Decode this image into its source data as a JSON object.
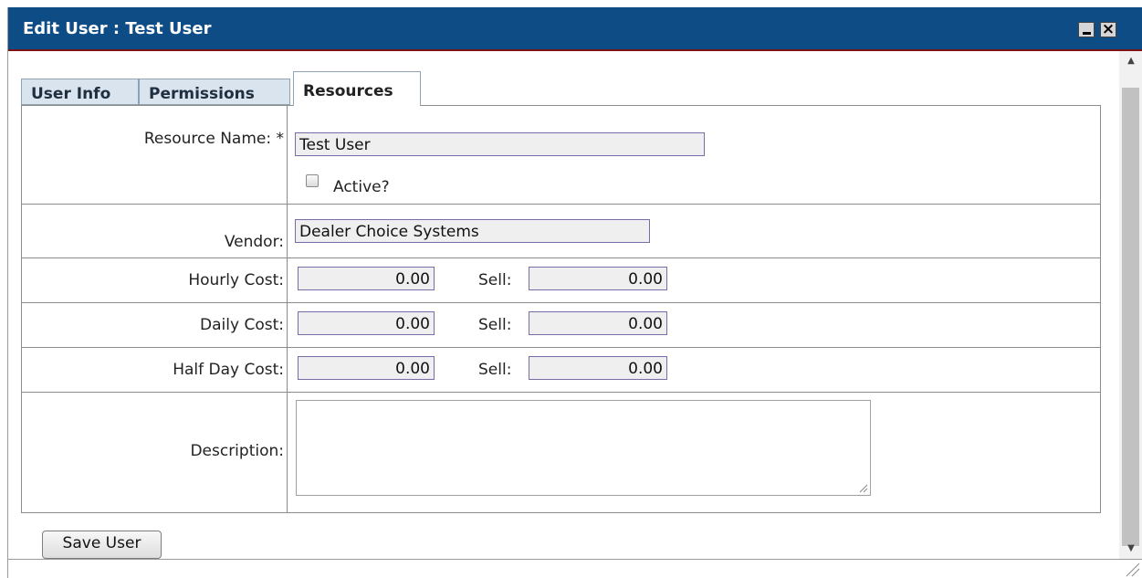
{
  "window": {
    "title": "Edit User : Test User",
    "minimize_icon": "minimize-icon",
    "close_glyph": "×"
  },
  "tabs": [
    {
      "label": "User Info",
      "active": false
    },
    {
      "label": "Permissions",
      "active": false
    },
    {
      "label": "Resources",
      "active": true
    }
  ],
  "form": {
    "resource_name": {
      "label": "Resource Name: *",
      "value": "Test User"
    },
    "active": {
      "label": "Active?",
      "checked": false
    },
    "vendor": {
      "label": "Vendor:",
      "value": "Dealer Choice Systems"
    },
    "hourly": {
      "label": "Hourly Cost:",
      "cost": "0.00",
      "sell_label": "Sell:",
      "sell": "0.00"
    },
    "daily": {
      "label": "Daily Cost:",
      "cost": "0.00",
      "sell_label": "Sell:",
      "sell": "0.00"
    },
    "half_day": {
      "label": "Half Day Cost:",
      "cost": "0.00",
      "sell_label": "Sell:",
      "sell": "0.00"
    },
    "description": {
      "label": "Description:",
      "value": ""
    }
  },
  "actions": {
    "save_label": "Save User"
  },
  "colors": {
    "titlebar": "#0e4c86",
    "input_border": "#7a6aa8",
    "tab_inactive": "#d9e4ee"
  }
}
